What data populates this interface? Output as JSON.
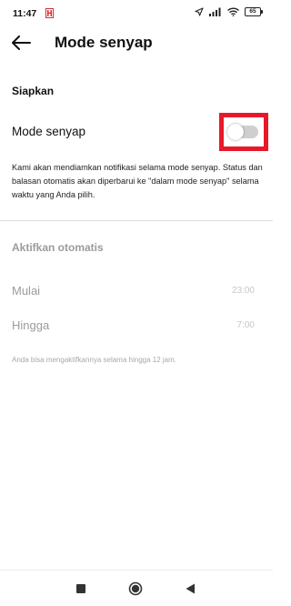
{
  "status_bar": {
    "time": "11:47",
    "notification_icon": "app-notification-icon",
    "icons": [
      "location-arrow-icon",
      "signal-icon",
      "wifi-icon"
    ],
    "battery_level": "65"
  },
  "app_bar": {
    "back_icon": "back-arrow-icon",
    "title": "Mode senyap"
  },
  "setup": {
    "header": "Siapkan",
    "toggle_label": "Mode senyap",
    "toggle_on": false,
    "highlight_color": "#e8182a",
    "description": "Kami akan mendiamkan notifikasi selama mode senyap. Status dan balasan otomatis akan diperbarui ke \"dalam mode senyap\" selama waktu yang Anda pilih."
  },
  "auto": {
    "header": "Aktifkan otomatis",
    "start_label": "Mulai",
    "start_time": "23:00",
    "end_label": "Hingga",
    "end_time": "7:00",
    "hint": "Anda bisa mengaktifkannya selama hingga 12 jam."
  },
  "nav_bar": {
    "buttons": [
      "recent-apps-icon",
      "home-icon",
      "back-triangle-icon"
    ]
  }
}
